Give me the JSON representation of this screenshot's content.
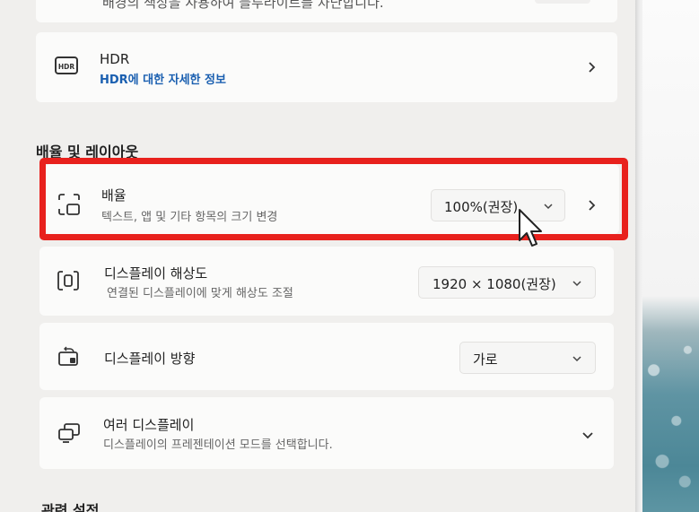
{
  "top_card": {
    "text": "배경의 색상을 사용하여 블루라이트를 차단합니다."
  },
  "hdr": {
    "title": "HDR",
    "link": "HDR에 대한 자세한 정보",
    "icon": "hdr-icon",
    "badge": "HDR"
  },
  "section": {
    "title": "배율 및 레이아웃"
  },
  "scale": {
    "title": "배율",
    "subtitle": "텍스트, 앱 및 기타 항목의 크기 변경",
    "value": "100%(권장)",
    "icon": "scale-icon"
  },
  "resolution": {
    "title": "디스플레이 해상도",
    "subtitle": "연결된 디스플레이에 맞게 해상도 조절",
    "value": "1920 × 1080(권장)",
    "icon": "resolution-icon"
  },
  "orientation": {
    "title": "디스플레이 방향",
    "value": "가로",
    "icon": "orientation-icon"
  },
  "multi": {
    "title": "여러 디스플레이",
    "subtitle": "디스플레이의 프레젠테이션 모드를 선택합니다.",
    "icon": "multi-display-icon"
  },
  "related": {
    "title": "관련 설정"
  },
  "colors": {
    "highlight": "#e8211d",
    "link": "#1a5fb0",
    "card": "#fbfbfa",
    "background": "#f0efed"
  }
}
